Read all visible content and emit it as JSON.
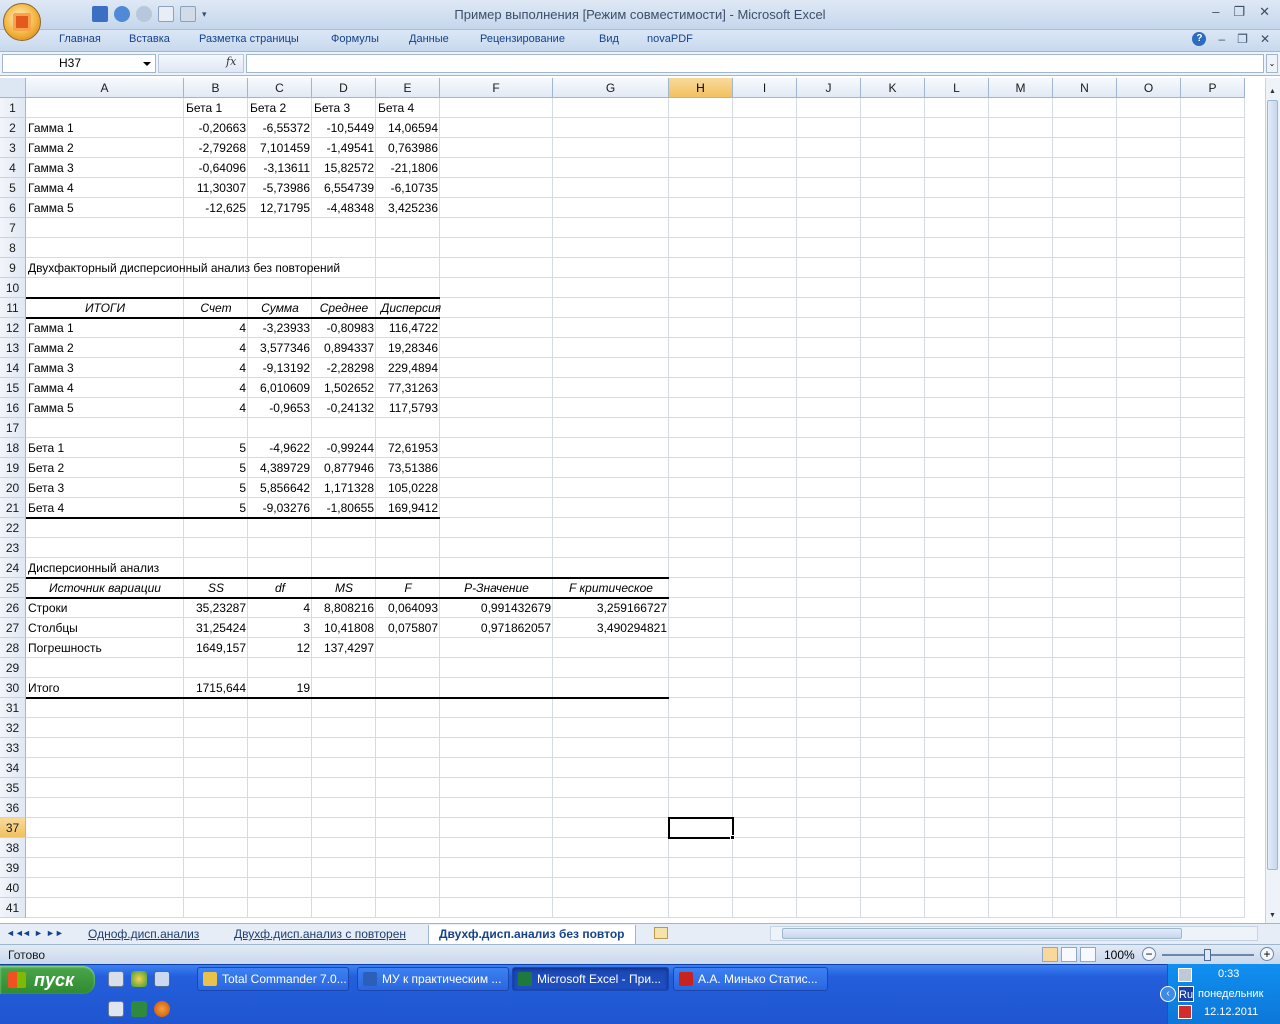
{
  "window": {
    "title": "Пример выполнения  [Режим совместимости] - Microsoft Excel",
    "controls": [
      "–",
      "❐",
      "✕"
    ]
  },
  "ribbon": {
    "tabs": [
      "Главная",
      "Вставка",
      "Разметка страницы",
      "Формулы",
      "Данные",
      "Рецензирование",
      "Вид",
      "novaPDF"
    ],
    "help": "?"
  },
  "formula_bar": {
    "name_box": "H37",
    "fx": "fx",
    "formula": ""
  },
  "grid": {
    "columns": [
      "A",
      "B",
      "C",
      "D",
      "E",
      "F",
      "G",
      "H",
      "I",
      "J",
      "K",
      "L",
      "M",
      "N",
      "O",
      "P"
    ],
    "rows": [
      "1",
      "2",
      "3",
      "4",
      "5",
      "6",
      "7",
      "8",
      "9",
      "10",
      "11",
      "12",
      "13",
      "14",
      "15",
      "16",
      "17",
      "18",
      "19",
      "20",
      "21",
      "22",
      "23",
      "24",
      "25",
      "26",
      "27",
      "28",
      "29",
      "30",
      "31",
      "32",
      "33",
      "34",
      "35",
      "36",
      "37",
      "38",
      "39",
      "40",
      "41"
    ],
    "selected_cell": "H37",
    "cells": {
      "r1": [
        "",
        "Бета 1",
        "Бета 2",
        "Бета 3",
        "Бета 4"
      ],
      "r2": [
        "Гамма 1",
        "-0,20663",
        "-6,55372",
        "-10,5449",
        "14,06594"
      ],
      "r3": [
        "Гамма 2",
        "-2,79268",
        "7,101459",
        "-1,49541",
        "0,763986"
      ],
      "r4": [
        "Гамма 3",
        "-0,64096",
        "-3,13611",
        "15,82572",
        "-21,1806"
      ],
      "r5": [
        "Гамма 4",
        "11,30307",
        "-5,73986",
        "6,554739",
        "-6,10735"
      ],
      "r6": [
        "Гамма 5",
        "-12,625",
        "12,71795",
        "-4,48348",
        "3,425236"
      ],
      "r9": [
        "Двухфакторный дисперсионный анализ без повторений"
      ],
      "r11": [
        "ИТОГИ",
        "Счет",
        "Сумма",
        "Среднее",
        "Дисперсия"
      ],
      "r12": [
        "Гамма 1",
        "4",
        "-3,23933",
        "-0,80983",
        "116,4722"
      ],
      "r13": [
        "Гамма 2",
        "4",
        "3,577346",
        "0,894337",
        "19,28346"
      ],
      "r14": [
        "Гамма 3",
        "4",
        "-9,13192",
        "-2,28298",
        "229,4894"
      ],
      "r15": [
        "Гамма 4",
        "4",
        "6,010609",
        "1,502652",
        "77,31263"
      ],
      "r16": [
        "Гамма 5",
        "4",
        "-0,9653",
        "-0,24132",
        "117,5793"
      ],
      "r18": [
        "Бета 1",
        "5",
        "-4,9622",
        "-0,99244",
        "72,61953"
      ],
      "r19": [
        "Бета 2",
        "5",
        "4,389729",
        "0,877946",
        "73,51386"
      ],
      "r20": [
        "Бета 3",
        "5",
        "5,856642",
        "1,171328",
        "105,0228"
      ],
      "r21": [
        "Бета 4",
        "5",
        "-9,03276",
        "-1,80655",
        "169,9412"
      ],
      "r24": [
        "Дисперсионный анализ"
      ],
      "r25": [
        "Источник вариации",
        "SS",
        "df",
        "MS",
        "F",
        "P-Значение",
        "F критическое"
      ],
      "r26": [
        "Строки",
        "35,23287",
        "4",
        "8,808216",
        "0,064093",
        "0,991432679",
        "3,259166727"
      ],
      "r27": [
        "Столбцы",
        "31,25424",
        "3",
        "10,41808",
        "0,075807",
        "0,971862057",
        "3,490294821"
      ],
      "r28": [
        "Погрешность",
        "1649,157",
        "12",
        "137,4297",
        "",
        "",
        ""
      ],
      "r30": [
        "Итого",
        "1715,644",
        "19"
      ]
    }
  },
  "sheet_tabs": {
    "nav": [
      "◄◄",
      "◄",
      "►",
      "►►"
    ],
    "tabs": [
      "Одноф.дисп.анализ",
      "Двухф.дисп.анализ с повторен",
      "Двухф.дисп.анализ без повтор"
    ],
    "active_index": 2
  },
  "status_bar": {
    "status": "Готово",
    "zoom": "100%",
    "zoom_minus": "−",
    "zoom_plus": "+"
  },
  "taskbar": {
    "start_label": "пуск",
    "windows": [
      {
        "label": "Total Commander 7.0...",
        "icon_color": "#e8c24a"
      },
      {
        "label": "МУ к практическим ...",
        "icon_color": "#2b5fb8"
      },
      {
        "label": "Microsoft Excel - При...",
        "icon_color": "#1e7a3c"
      },
      {
        "label": "А.А. Минько Статис...",
        "icon_color": "#c8231f"
      }
    ],
    "active_window": 2,
    "tray": {
      "time": "0:33",
      "day": "понедельник",
      "date": "12.12.2011",
      "lang": "Ru"
    }
  },
  "colors": {
    "accent": "#15428b",
    "selected_header": "#f1c15f",
    "taskbar": "#245edb",
    "start_button": "#2f8a30"
  }
}
